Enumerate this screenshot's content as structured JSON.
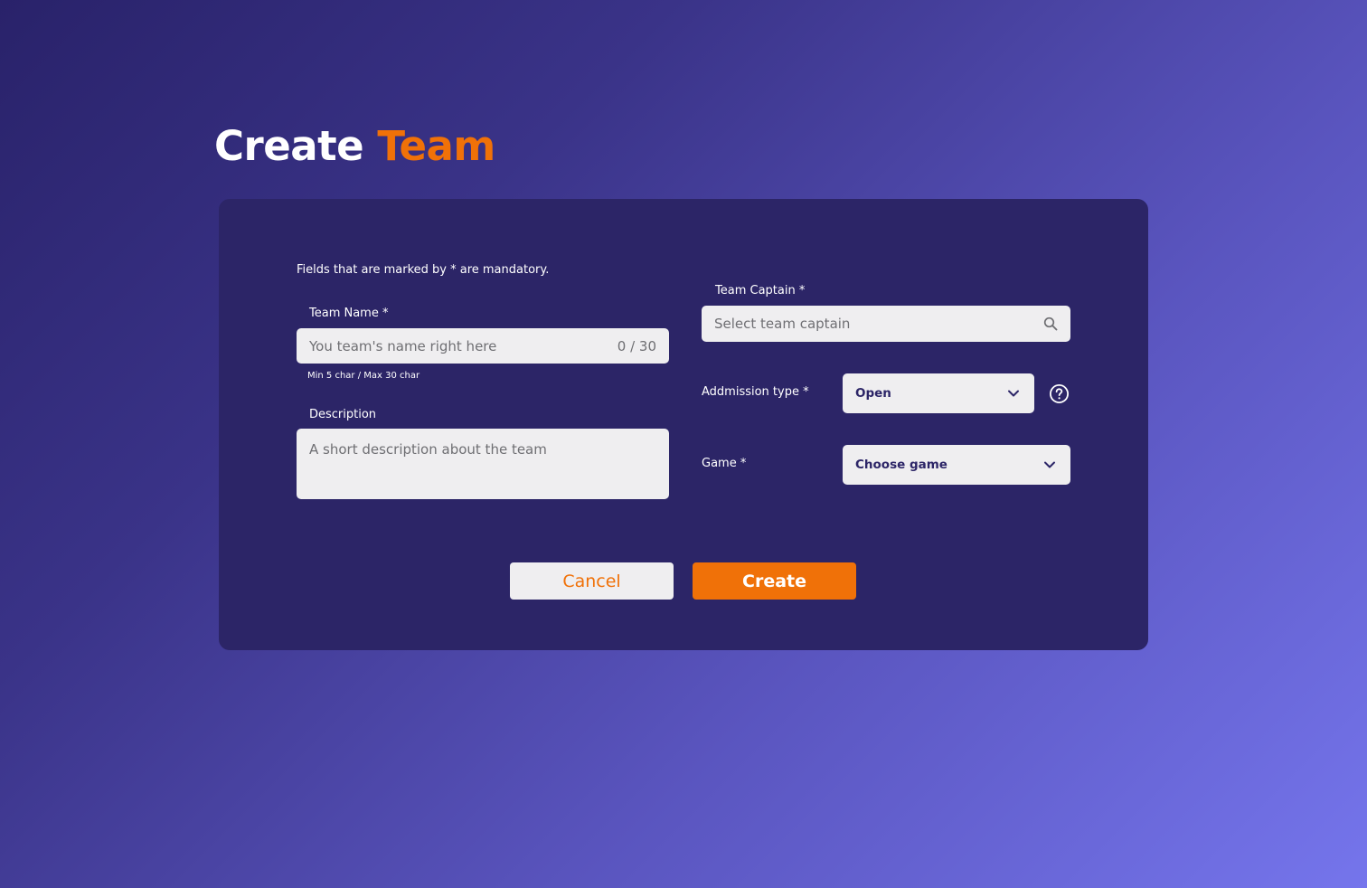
{
  "header": {
    "title_main": "Create",
    "title_accent": "Team"
  },
  "form": {
    "mandatory_note": "Fields that are marked by * are mandatory.",
    "team_name": {
      "label": "Team Name *",
      "placeholder": "You team's name right here",
      "counter": "0 / 30",
      "hint": "Min 5 char / Max 30 char"
    },
    "description": {
      "label": "Description",
      "placeholder": "A short description about the team"
    },
    "team_captain": {
      "label": "Team Captain *",
      "placeholder": "Select team captain",
      "icon": "search-icon"
    },
    "admission_type": {
      "label": "Addmission type *",
      "value": "Open",
      "help_icon": "help-circle-icon"
    },
    "game": {
      "label": "Game  *",
      "value": "Choose game"
    }
  },
  "actions": {
    "cancel_label": "Cancel",
    "create_label": "Create"
  },
  "colors": {
    "accent": "#f07108",
    "card": "#2c2567",
    "field": "#efeef0"
  }
}
